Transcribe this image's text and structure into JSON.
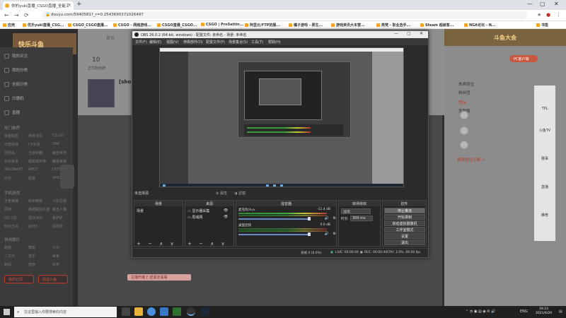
{
  "browser": {
    "tab_title": "你的yuki直播_CSGO直播_全能工",
    "url": "douyu.com/5940581?_r=0.2543690371026497",
    "new_tab": "+",
    "win_controls": [
      "—",
      "▢",
      "✕"
    ]
  },
  "bookmarks": [
    "应用",
    "优乐yuki直播_CSG...",
    "CSGO_CSGO直播...",
    "CSGO - 网络游戏...",
    "CSGO直播_CSGO...",
    "CSGO | ProSettin...",
    "阿里云/FTP的服...",
    "橘子游戏 - 原生...",
    "游戏资讯大本营...",
    "英梵 - 职业选手...",
    "Steam 超级客...",
    "NGA论坛 - N...",
    "书签"
  ],
  "page": {
    "logo": "快乐斗鱼",
    "top_nav": "首页",
    "count": "10",
    "count_sub": "正式粉丝牌",
    "streamer_name": "[sho",
    "sidebar_items": [
      "我的关注",
      "我的分类",
      "全部分类",
      "兰德机",
      "直播"
    ],
    "sidebar_section1": "热门推荐",
    "sidebar_grid": [
      [
        "英雄联盟",
        "绝地求生",
        "CS:GO"
      ],
      [
        "守望先锋",
        "CF手游",
        "DNF"
      ],
      [
        "冒险岛",
        "王者荣耀",
        "魔兽世界"
      ],
      [
        "炉石传说",
        "暗黑破坏神",
        "魔兽争霸"
      ],
      [
        "VALORANT",
        "APEX",
        "DOTA2"
      ],
      [
        "户外",
        "颜值",
        "APEX"
      ]
    ],
    "sidebar_section2": "手机游戏",
    "sidebar_grid2": [
      [
        "王者荣耀",
        "和平精英",
        "火影忍者"
      ],
      [
        "原神",
        "英雄联盟手游",
        "第五人格"
      ],
      [
        "QQ飞车",
        "蛋仔派对",
        "金铲铲"
      ],
      [
        "明日方舟",
        "崩坏3",
        "阴阳师"
      ]
    ],
    "sidebar_section3": "休闲娱乐",
    "sidebar_grid3": [
      [
        "颜值",
        "舞蹈",
        "户外"
      ],
      [
        "二次元",
        "音乐",
        "美食"
      ],
      [
        "数码",
        "旅游",
        "体育"
      ],
      [
        "汽车",
        "娱乐",
        "科技"
      ]
    ],
    "sidebar_btn1": "我的订阅",
    "sidebar_btn2": "前往斗鱼",
    "rc_banner": "斗鱼大会",
    "pc_btn": "PC客户端",
    "rc_lines": [
      "贵宾席位",
      "粉丝团",
      "提示",
      "贡献榜"
    ],
    "rc_red": "贵宾席位还剩 >",
    "ad_cells": [
      "TPL",
      "斗鱼TV",
      "赛事",
      "直播",
      "推荐"
    ],
    "bottom_badge": "主播开播了 赶紧去看看"
  },
  "obs": {
    "title": "OBS 26.0.2 (64-bit, windows) - 配置文件: 未命名 - 场景: 未命名",
    "menu": [
      "文件(F)",
      "编辑(E)",
      "视图(V)",
      "停靠部件(D)",
      "配置文件(P)",
      "场景集合(S)",
      "工具(T)",
      "帮助(H)"
    ],
    "source_label": "未选择源",
    "props_btn": "属性",
    "filter_btn": "滤镜",
    "scenes_header": "场景",
    "scenes": [
      "场景"
    ],
    "sources_header": "来源",
    "sources": [
      "显示器采集",
      "局域网"
    ],
    "mixer_header": "混音器",
    "mixer": [
      {
        "name": "麦克风/Aux",
        "db": "-11.4 dB"
      },
      {
        "name": "桌面音频",
        "db": "0.0 dB"
      }
    ],
    "transitions_header": "转场特效",
    "transition_type": "淡出",
    "duration_label": "时长",
    "duration_value": "300 ms",
    "controls_header": "控件",
    "controls": [
      "停止推流",
      "开始录制",
      "启动虚拟摄像机",
      "工作室模式",
      "设置",
      "退出"
    ],
    "status": {
      "drop": "丢帧 0 (0.0%)",
      "live": "LIVE: 00:00:00",
      "rec": "REC: 00:00:00",
      "cpu": "CPU: 2.0%, 60.00 fps"
    },
    "dock_footer": "+ − ∧ ∨"
  },
  "taskbar": {
    "search_placeholder": "在这里输入你要搜索的内容",
    "lang": "ENG",
    "time": "19:23",
    "date": "2021/6/20"
  }
}
